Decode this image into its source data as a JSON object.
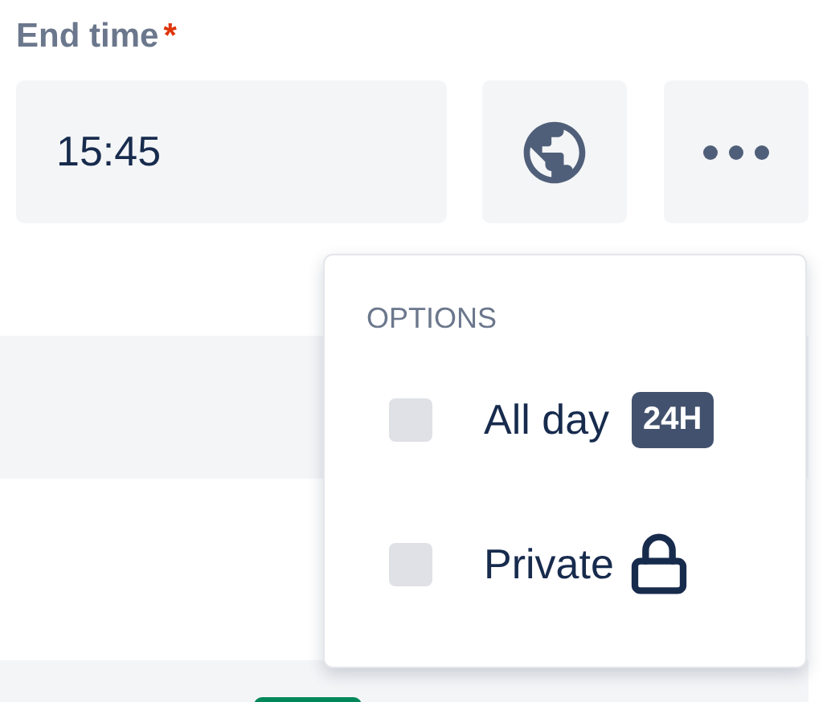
{
  "field": {
    "label": "End time",
    "required_mark": "*",
    "value": "15:45"
  },
  "menu": {
    "heading": "OPTIONS",
    "options": [
      {
        "kind": "badge",
        "label": "All day",
        "badge": "24H",
        "checked": false
      },
      {
        "kind": "lock",
        "label": "Private",
        "checked": false
      }
    ]
  }
}
